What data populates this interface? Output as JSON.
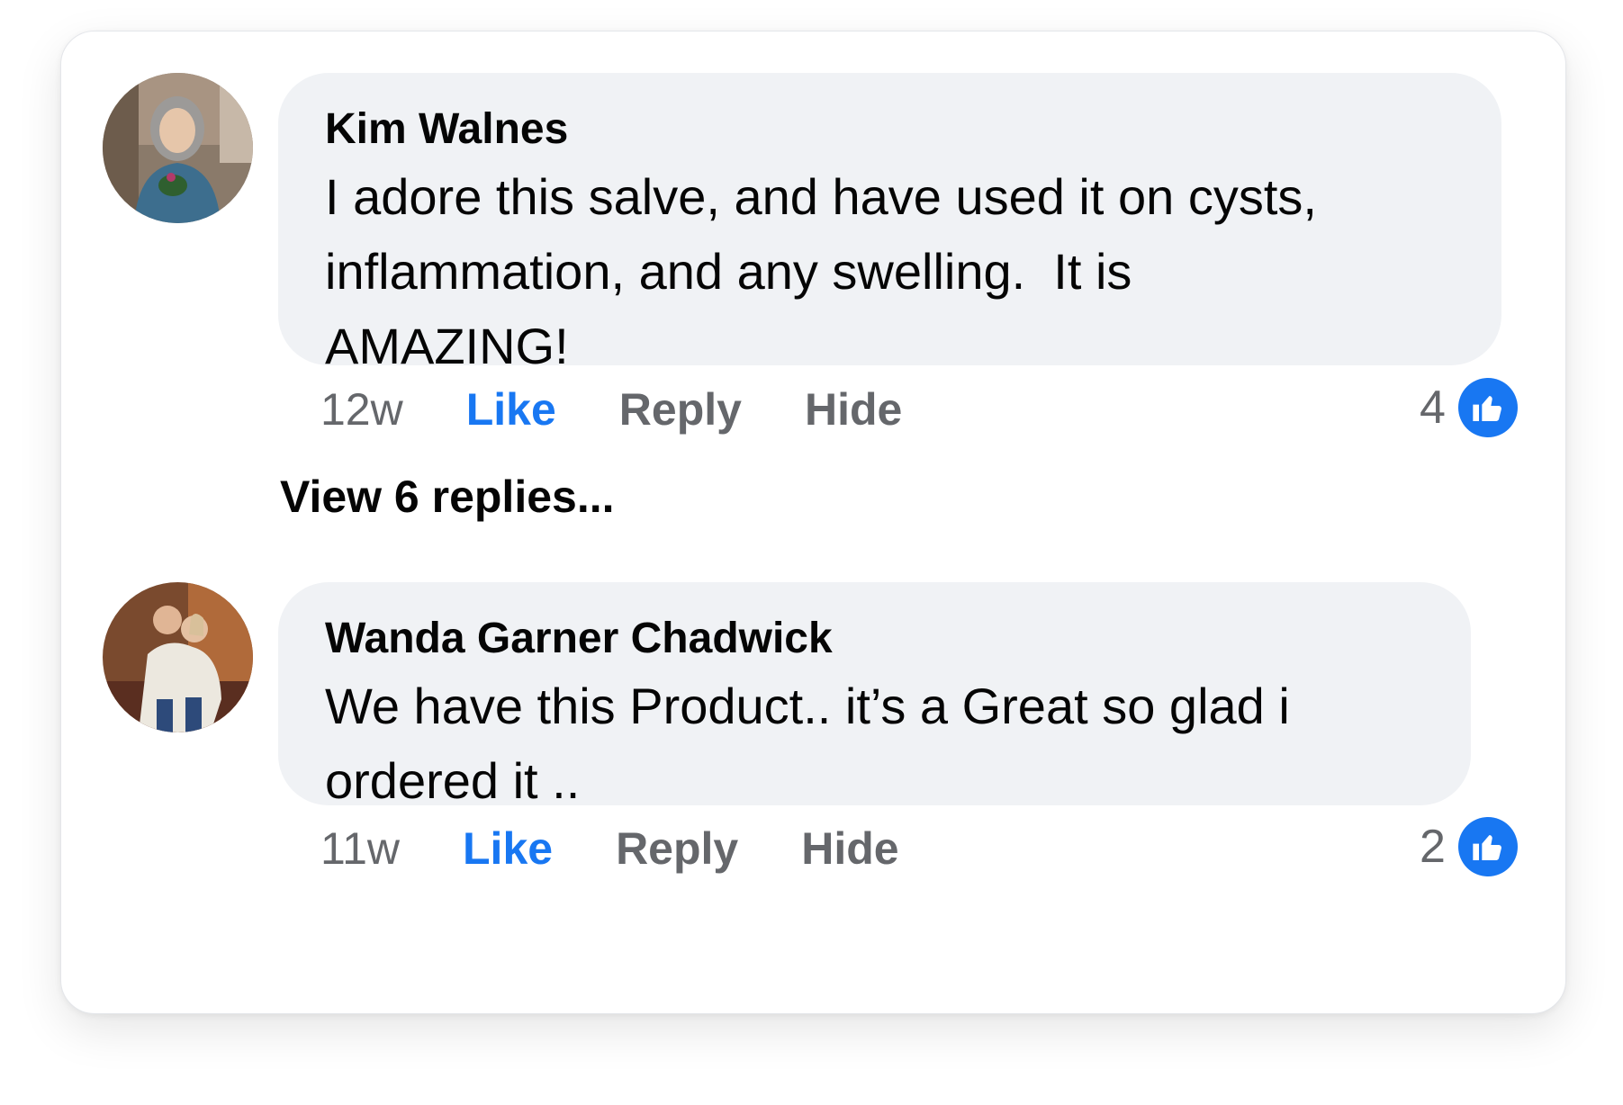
{
  "comments": [
    {
      "author": "Kim Walnes",
      "text": "I adore this salve, and have used it on cysts,\ninflammation, and any swelling.  It is\nAMAZING!",
      "time": "12w",
      "like_label": "Like",
      "reply_label": "Reply",
      "hide_label": "Hide",
      "reaction_count": "4",
      "reaction_icon": "thumbs-up-icon"
    },
    {
      "author": "Wanda Garner Chadwick",
      "text": "We have this Product.. it’s a Great so glad i\nordered it ..",
      "time": "11w",
      "like_label": "Like",
      "reply_label": "Reply",
      "hide_label": "Hide",
      "reaction_count": "2",
      "reaction_icon": "thumbs-up-icon"
    }
  ],
  "view_replies": "View 6 replies...",
  "colors": {
    "like_blue": "#1877f2",
    "bubble_bg": "#f0f2f5",
    "secondary_text": "#65676b",
    "primary_text": "#050505"
  }
}
